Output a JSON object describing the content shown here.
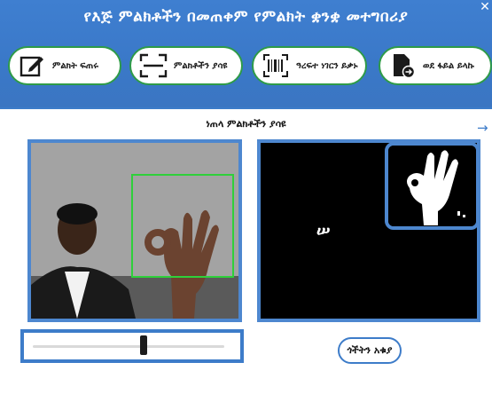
{
  "window": {
    "title": "የእጅ ምልክቶችን በመጠቀም የምልክት ቋንቋ መተግበሪያ",
    "close_glyph": "✕"
  },
  "toolbar": [
    {
      "label": "ምልክት ፍጠሩ",
      "icon": "edit-icon"
    },
    {
      "label": "ምልክቶችን ያሳዩ",
      "icon": "scan-frame-icon"
    },
    {
      "label": "ዓረፍተ ነገርን ይቃኑ",
      "icon": "barcode-scan-icon"
    },
    {
      "label": "ወደ ፋይል ይላኩ",
      "icon": "export-file-icon"
    }
  ],
  "main": {
    "title": "ነጠላ ምልክቶችን ያሳዩ",
    "nav_arrow": "→",
    "predicted_character": "ሠ",
    "threshold_slider": {
      "value_fraction": 0.58
    },
    "clear_button": "ጎችትን አቁያ"
  },
  "colors": {
    "header": "#3b78c8",
    "frame": "#4d87cf",
    "roi": "#2ed03a",
    "button_border": "#2e9b48"
  }
}
